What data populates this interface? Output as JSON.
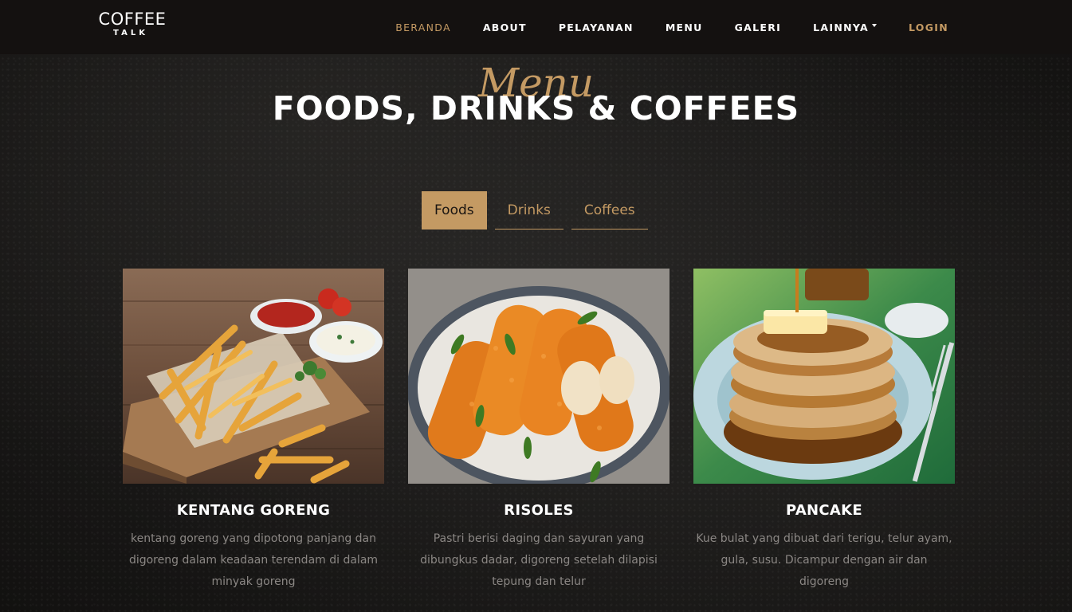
{
  "brand": {
    "top": "COFFEE",
    "bottom": "TALK"
  },
  "nav": {
    "items": [
      {
        "label": "BERANDA",
        "active": true
      },
      {
        "label": "ABOUT"
      },
      {
        "label": "PELAYANAN"
      },
      {
        "label": "MENU"
      },
      {
        "label": "GALERI"
      },
      {
        "label": "LAINNYA",
        "dropdown": true
      },
      {
        "label": "LOGIN"
      }
    ]
  },
  "section": {
    "subheading": "Menu",
    "heading": "FOODS, DRINKS & COFFEES"
  },
  "tabs": [
    {
      "label": "Foods",
      "active": true
    },
    {
      "label": "Drinks"
    },
    {
      "label": "Coffees"
    }
  ],
  "items": [
    {
      "title": "KENTANG GORENG",
      "description": "kentang goreng yang dipotong panjang dan digoreng dalam keadaan terendam di dalam minyak goreng",
      "image": "french-fries-photo"
    },
    {
      "title": "RISOLES",
      "description": "Pastri berisi daging dan sayuran yang dibungkus dadar, digoreng setelah dilapisi tepung dan telur",
      "image": "risoles-photo"
    },
    {
      "title": "PANCAKE",
      "description": "Kue bulat yang dibuat dari terigu, telur ayam, gula, susu. Dicampur dengan air dan digoreng",
      "image": "pancake-photo"
    }
  ],
  "colors": {
    "accent": "#c49a63",
    "navbar": "#141110",
    "text": "#ffffff",
    "muted": "#8b8784"
  }
}
